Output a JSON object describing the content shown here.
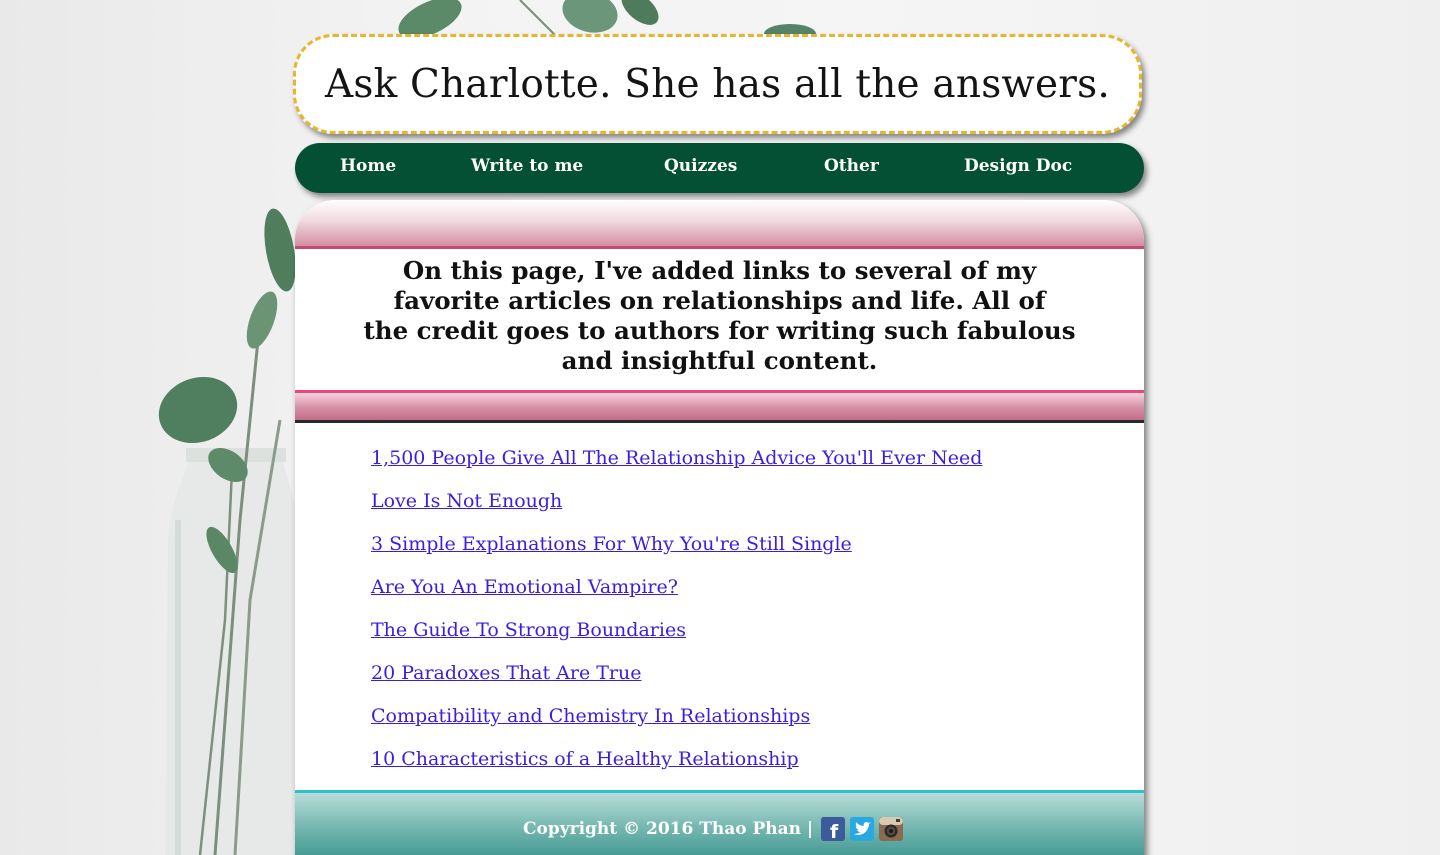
{
  "header": {
    "title": "Ask Charlotte. She has all the answers."
  },
  "nav": {
    "items": [
      {
        "label": "Home"
      },
      {
        "label": "Write to me"
      },
      {
        "label": "Quizzes"
      },
      {
        "label": "Other"
      },
      {
        "label": "Design Doc"
      }
    ]
  },
  "main": {
    "intro_lines": [
      "On this page, I've added links to several of my",
      "favorite articles on relationships and life. All of",
      "the credit goes to authors for writing such fabulous",
      "and insightful content."
    ],
    "links": [
      {
        "label": "1,500 People Give All The Relationship Advice You'll Ever Need"
      },
      {
        "label": "Love Is Not Enough"
      },
      {
        "label": "3 Simple Explanations For Why You're Still Single"
      },
      {
        "label": "Are You An Emotional Vampire?"
      },
      {
        "label": "The Guide To Strong Boundaries"
      },
      {
        "label": "20 Paradoxes That Are True"
      },
      {
        "label": "Compatibility and Chemistry In Relationships"
      },
      {
        "label": "10 Characteristics of a Healthy Relationship"
      }
    ]
  },
  "footer": {
    "copyright": "Copyright © 2016 Thao Phan |",
    "social": [
      {
        "icon": "facebook-icon",
        "glyph": "f"
      },
      {
        "icon": "twitter-icon",
        "glyph": ""
      },
      {
        "icon": "instagram-icon",
        "glyph": ""
      }
    ]
  },
  "colors": {
    "nav_bg": "#045034",
    "banner_border": "#e8b62c",
    "link": "#3b1de0",
    "pink_accent": "#e8477f",
    "teal_accent": "#2bc3c9"
  }
}
